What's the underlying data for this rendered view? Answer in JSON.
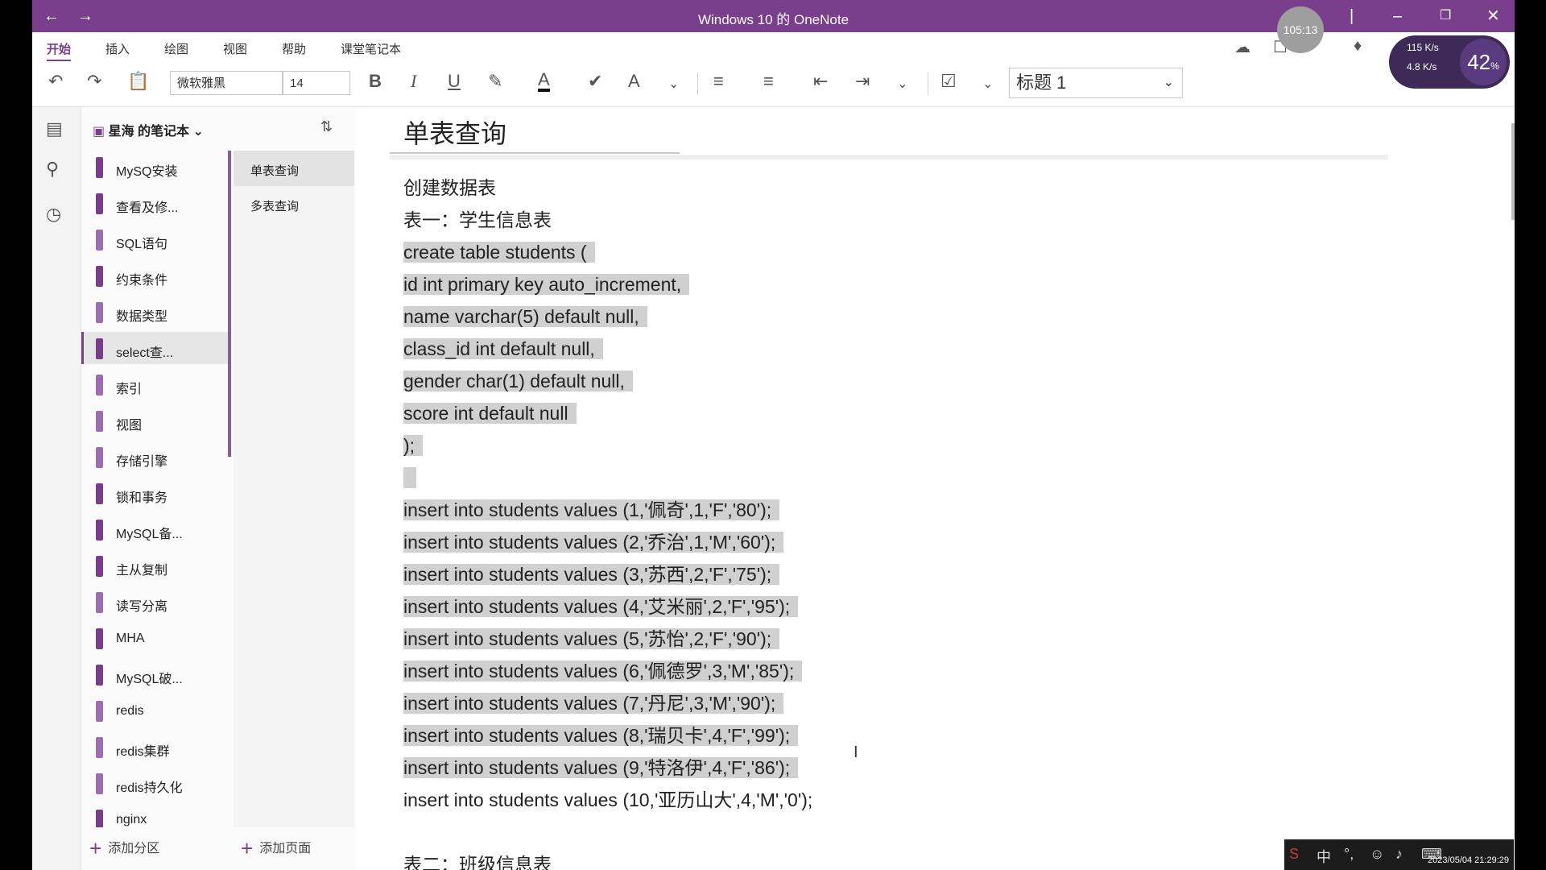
{
  "window": {
    "title": "Windows 10 的 OneNote",
    "accent": "#7a3f8c"
  },
  "ribbon": {
    "tabs": [
      "开始",
      "插入",
      "绘图",
      "视图",
      "帮助",
      "课堂笔记本"
    ],
    "font_name": "微软雅黑",
    "font_size": "14",
    "style": "标题 1"
  },
  "notebook": {
    "name": "星海 的笔记本",
    "sections": [
      {
        "label": "MySQ安装",
        "color": "#7b3a8f"
      },
      {
        "label": "查看及修...",
        "color": "#7b3a8f"
      },
      {
        "label": "SQL语句",
        "color": "#a06ab4"
      },
      {
        "label": "约束条件",
        "color": "#7b3a8f"
      },
      {
        "label": "数据类型",
        "color": "#a06ab4"
      },
      {
        "label": "select查...",
        "color": "#7b3a8f"
      },
      {
        "label": "索引",
        "color": "#a06ab4"
      },
      {
        "label": "视图",
        "color": "#a06ab4"
      },
      {
        "label": "存储引擎",
        "color": "#a06ab4"
      },
      {
        "label": "锁和事务",
        "color": "#7b3a8f"
      },
      {
        "label": "MySQL备...",
        "color": "#7b3a8f"
      },
      {
        "label": "主从复制",
        "color": "#7b3a8f"
      },
      {
        "label": "读写分离",
        "color": "#a06ab4"
      },
      {
        "label": "MHA",
        "color": "#7b3a8f"
      },
      {
        "label": "MySQL破...",
        "color": "#7b3a8f"
      },
      {
        "label": "redis",
        "color": "#a06ab4"
      },
      {
        "label": "redis集群",
        "color": "#a06ab4"
      },
      {
        "label": "redis持久化",
        "color": "#a06ab4"
      },
      {
        "label": "nginx",
        "color": "#7b3a8f"
      }
    ],
    "pages": [
      "单表查询",
      "多表查询"
    ],
    "add_section": "添加分区",
    "add_page": "添加页面"
  },
  "page": {
    "title": "单表查询",
    "lines": [
      {
        "text": "创建数据表",
        "hl": false
      },
      {
        "text": "表一：学生信息表",
        "hl": false
      },
      {
        "text": "create table students (",
        "hl": true
      },
      {
        "text": "id int primary key auto_increment,",
        "hl": true
      },
      {
        "text": "name varchar(5) default null,",
        "hl": true
      },
      {
        "text": "class_id int default null,",
        "hl": true
      },
      {
        "text": "gender char(1) default null,",
        "hl": true
      },
      {
        "text": "score int default null",
        "hl": true
      },
      {
        "text": ");",
        "hl": true
      },
      {
        "text": " ",
        "hl": true
      },
      {
        "text": "insert into students values (1,'佩奇',1,'F','80');",
        "hl": true
      },
      {
        "text": "insert into students values (2,'乔治',1,'M','60');",
        "hl": true
      },
      {
        "text": "insert into students values (3,'苏西',2,'F','75');",
        "hl": true
      },
      {
        "text": "insert into students values (4,'艾米丽',2,'F','95');",
        "hl": true
      },
      {
        "text": "insert into students values (5,'苏怡',2,'F','90');",
        "hl": true
      },
      {
        "text": "insert into students values (6,'佩德罗',3,'M','85');",
        "hl": true
      },
      {
        "text": "insert into students values (7,'丹尼',3,'M','90');",
        "hl": true
      },
      {
        "text": "insert into students values (8,'瑞贝卡',4,'F','99');",
        "hl": true
      },
      {
        "text": "insert into students values (9,'特洛伊',4,'F','86');",
        "hl": true
      },
      {
        "text": "insert into students values (10,'亚历山大',4,'M','0');",
        "hl": false
      },
      {
        "text": " ",
        "hl": false
      },
      {
        "text": "表二：班级信息表",
        "hl": false
      }
    ]
  },
  "overlays": {
    "timer": "105:13",
    "net_up": "115 K/s",
    "net_down": "4.8 K/s",
    "net_pct": "42",
    "clock": "2023/05/04 21:29:29"
  }
}
